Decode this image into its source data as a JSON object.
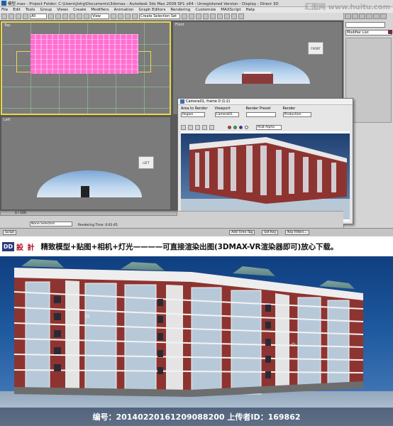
{
  "window": {
    "title": "模型.max  - Project Folder: C:\\Users\\jishg\\Documents\\3dsmax  - Autodesk 3ds Max 2009 SP1 x64 - Unregistered Version  - Display : Direct 3D"
  },
  "watermark_site": "汇图网 www.huitu.com",
  "menu": [
    "File",
    "Edit",
    "Tools",
    "Group",
    "Views",
    "Create",
    "Modifiers",
    "Animation",
    "Graph Editors",
    "Rendering",
    "Customize",
    "MAXScript",
    "Help"
  ],
  "toolbar": {
    "filter": "All",
    "view": "View",
    "selection_set": "Create Selection Set"
  },
  "viewports": {
    "top_label": "Top",
    "front_label": "Front",
    "left_label": "Left",
    "front_cube": "FRONT",
    "left_cube": "LEFT"
  },
  "command_panel": {
    "modifier_list": "Modifier List",
    "swatch_color": "#b01030"
  },
  "render_window": {
    "title": "Camera01, frame 0 (1:2)",
    "area_label": "Area to Render",
    "area_value": "Region",
    "viewport_label": "Viewport",
    "viewport_value": "Camera01",
    "preset_label": "Render Preset",
    "render_label": "Render",
    "render_value": "Production",
    "channel": "RGB Alpha"
  },
  "status": {
    "timeline": "0 / 100",
    "selection": "None Selected",
    "render_time": "Rendering Time: 0:01:45",
    "script": "Script",
    "add_time_tag": "Add Time Tag",
    "set_key": "Set Key",
    "key_filters": "Key Filters..."
  },
  "promo": {
    "logo": "DD",
    "logo_text": "設 計",
    "text": "精致模型+贴图+相机+灯光————可直接渲染出图(3DMAX-VR渲染器即可)放心下载。"
  },
  "caption": {
    "text": "编号：20140220161209088200 上传者ID：169862"
  },
  "colors": {
    "brick": "#8e3430",
    "sky_top": "#0f3f80",
    "selection_yellow": "#e9d84a",
    "pink_model": "#ff6fd0"
  }
}
